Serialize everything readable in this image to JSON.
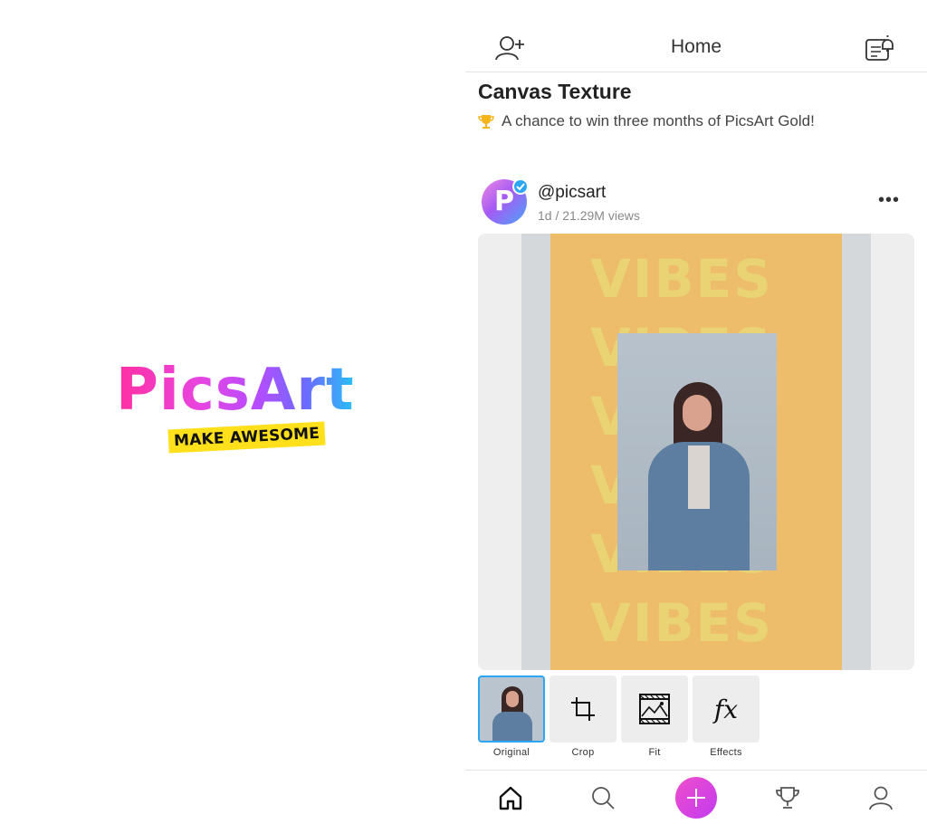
{
  "splash": {
    "logo_text": "PicsArt",
    "tagline": "MAKE AWESOME"
  },
  "header": {
    "title": "Home",
    "left_icon": "add-user-icon",
    "right_icon": "notifications-icon"
  },
  "challenge": {
    "title": "Canvas Texture",
    "subtitle": "A chance to win three months of PicsArt Gold!",
    "icon": "trophy-icon",
    "icon_color": "#f5b51b"
  },
  "post": {
    "author": "@picsart",
    "meta": "1d / 21.29M views",
    "avatar_letter": "P",
    "verified_color": "#2aa6f5",
    "more_label": "•••",
    "background_word": "VIBES"
  },
  "tools": [
    {
      "label": "Original",
      "icon": "image-thumbnail",
      "selected": true
    },
    {
      "label": "Crop",
      "icon": "crop-icon",
      "selected": false
    },
    {
      "label": "Fit",
      "icon": "fit-icon",
      "selected": false
    },
    {
      "label": "Effects",
      "icon": "fx-icon",
      "glyph": "fx",
      "selected": false
    }
  ],
  "bottom_nav": [
    {
      "name": "home",
      "icon": "home-icon"
    },
    {
      "name": "search",
      "icon": "search-icon"
    },
    {
      "name": "create",
      "icon": "plus-icon"
    },
    {
      "name": "challenges",
      "icon": "trophy-icon"
    },
    {
      "name": "profile",
      "icon": "profile-icon"
    }
  ],
  "colors": {
    "accent": "#c23bf0",
    "brand_pink": "#ff2fa0",
    "brand_blue": "#27c1f5",
    "tagline_bg": "#ffe01a"
  }
}
